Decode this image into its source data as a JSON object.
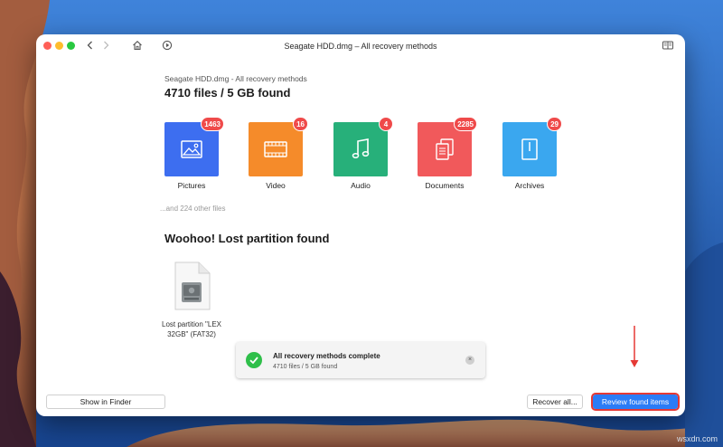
{
  "window": {
    "title": "Seagate HDD.dmg – All recovery methods"
  },
  "scan": {
    "subtitle": "Seagate HDD.dmg - All recovery methods",
    "headline": "4710 files / 5 GB found",
    "other_files": "...and 224 other files"
  },
  "categories": [
    {
      "label": "Pictures",
      "count": "1463",
      "icon": "picture-icon",
      "color": "#3d6ef0"
    },
    {
      "label": "Video",
      "count": "16",
      "icon": "film-icon",
      "color": "#f58b2a"
    },
    {
      "label": "Audio",
      "count": "4",
      "icon": "music-note-icon",
      "color": "#27b07a"
    },
    {
      "label": "Documents",
      "count": "2285",
      "icon": "documents-icon",
      "color": "#f1595b"
    },
    {
      "label": "Archives",
      "count": "29",
      "icon": "archive-icon",
      "color": "#3aa7ef"
    }
  ],
  "partition": {
    "title": "Woohoo! Lost partition found",
    "label_line1": "Lost partition \"LEX",
    "label_line2": "32GB\" (FAT32)"
  },
  "toast": {
    "title": "All recovery methods complete",
    "subtitle": "4710 files / 5 GB found"
  },
  "footer": {
    "show_in_finder": "Show in Finder",
    "recover_all": "Recover all...",
    "review_found": "Review found items"
  },
  "watermark": "wsxdn.com",
  "colors": {
    "accent": "#2b7cf6",
    "badge": "#ef4a4a",
    "highlight": "#e53935"
  }
}
